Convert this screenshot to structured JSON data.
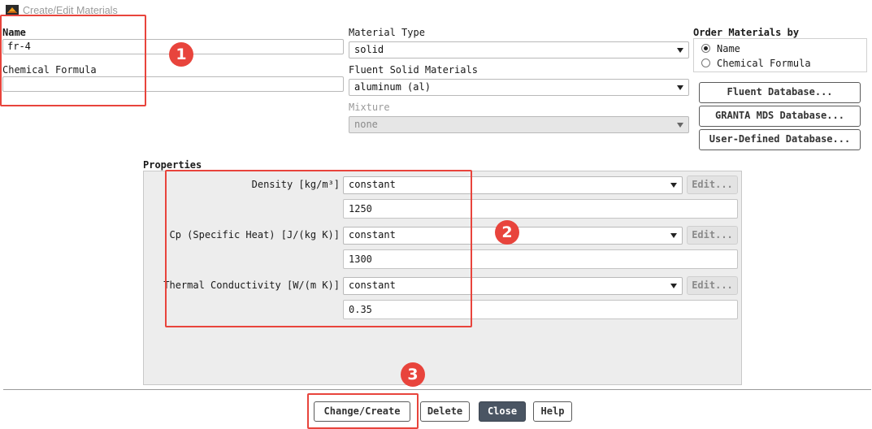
{
  "window": {
    "title": "Create/Edit Materials"
  },
  "name_field": {
    "label": "Name",
    "value": "fr-4"
  },
  "formula_field": {
    "label": "Chemical Formula",
    "value": ""
  },
  "material_type": {
    "label": "Material Type",
    "value": "solid"
  },
  "fluent_solid": {
    "label": "Fluent Solid Materials",
    "value": "aluminum (al)"
  },
  "mixture": {
    "label": "Mixture",
    "value": "none"
  },
  "order_by": {
    "label": "Order Materials by",
    "options": [
      "Name",
      "Chemical Formula"
    ],
    "selected": "Name"
  },
  "databases": {
    "fluent": "Fluent Database...",
    "granta": "GRANTA MDS Database...",
    "user_defined": "User-Defined Database..."
  },
  "properties": {
    "label": "Properties",
    "items": [
      {
        "label": "Density [kg/m³]",
        "method": "constant",
        "value": "1250",
        "edit": "Edit..."
      },
      {
        "label": "Cp (Specific Heat) [J/(kg K)]",
        "method": "constant",
        "value": "1300",
        "edit": "Edit..."
      },
      {
        "label": "Thermal Conductivity [W/(m K)]",
        "method": "constant",
        "value": "0.35",
        "edit": "Edit..."
      }
    ]
  },
  "actions": {
    "change_create": "Change/Create",
    "delete": "Delete",
    "close": "Close",
    "help": "Help"
  },
  "annotations": [
    "1",
    "2",
    "3"
  ],
  "colors": {
    "annotation": "#e8443c",
    "close_button": "#4a5563"
  }
}
